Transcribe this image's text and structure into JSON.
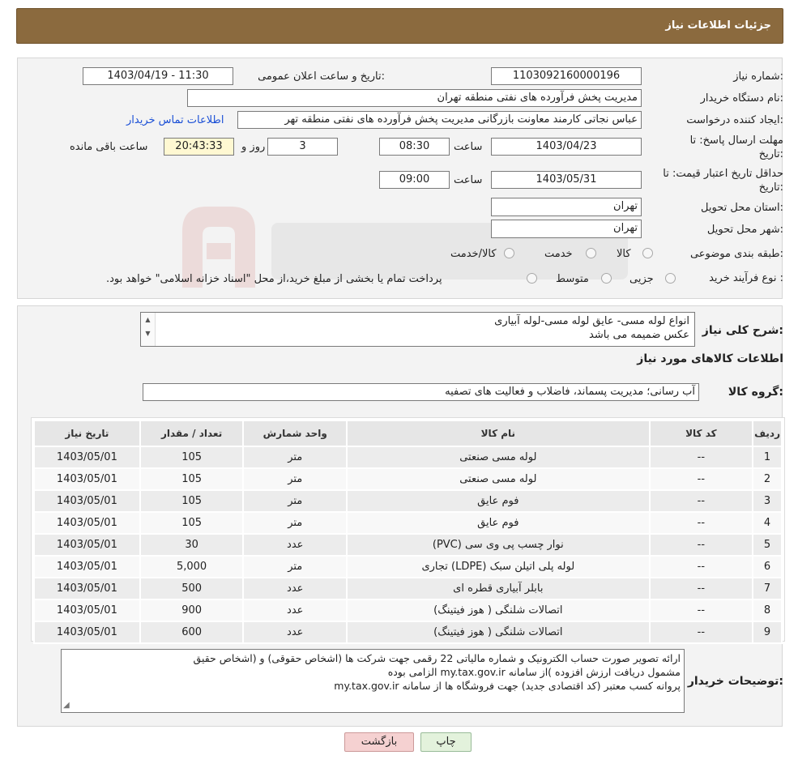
{
  "header": {
    "title": "جزئیات اطلاعات نیاز"
  },
  "form": {
    "need_number_label": "شماره نیاز:",
    "need_number": "1103092160000196",
    "announce_label": "تاریخ و ساعت اعلان عمومی:",
    "announce_value": "1403/04/19 - 11:30",
    "buyer_org_label": "نام دستگاه خریدار:",
    "buyer_org": "مدیریت پخش فرآورده های نفتی منطقه تهران",
    "creator_label": "ایجاد کننده درخواست:",
    "creator": "عباس نجاتی کارمند معاونت بازرگانی مدیریت پخش فرآورده های نفتی منطقه تهر",
    "contact_link": "اطلاعات تماس خریدار",
    "deadline_label_1": "مهلت ارسال پاسخ: تا",
    "deadline_label_2": "تاریخ:",
    "deadline_date": "1403/04/23",
    "time_label": "ساعت",
    "deadline_time": "08:30",
    "days_value": "3",
    "days_label": "روز و",
    "remaining_time": "20:43:33",
    "remaining_label": "ساعت باقی مانده",
    "validity_label_1": "حداقل تاریخ اعتبار قیمت: تا",
    "validity_label_2": "تاریخ:",
    "validity_date": "1403/05/31",
    "validity_time": "09:00",
    "province_label": "استان محل تحویل:",
    "province": "تهران",
    "city_label": "شهر محل تحویل:",
    "city": "تهران",
    "category_label": "طبقه بندی موضوعی:",
    "category_options": [
      "کالا",
      "خدمت",
      "کالا/خدمت"
    ],
    "process_label": "نوع فرآیند خرید :",
    "process_options": [
      "جزیی",
      "متوسط"
    ],
    "process_note": "پرداخت تمام یا بخشی از مبلغ خرید،از محل \"اسناد خزانه اسلامی\" خواهد بود."
  },
  "details": {
    "summary_label": "شرح کلی نیاز:",
    "summary_lines": [
      "انواع لوله مسی- عایق لوله مسی-لوله آبیاری",
      "عکس ضمیمه می باشد"
    ],
    "goods_info_title": "اطلاعات کالاهای مورد نیاز",
    "goods_group_label": "گروه کالا:",
    "goods_group": "آب رسانی؛ مدیریت پسماند، فاضلاب و فعالیت های تصفیه",
    "columns": [
      "ردیف",
      "کد کالا",
      "نام کالا",
      "واحد شمارش",
      "تعداد / مقدار",
      "تاریخ نیاز"
    ],
    "rows": [
      [
        "1",
        "--",
        "لوله مسی صنعتی",
        "متر",
        "105",
        "1403/05/01"
      ],
      [
        "2",
        "--",
        "لوله مسی صنعتی",
        "متر",
        "105",
        "1403/05/01"
      ],
      [
        "3",
        "--",
        "فوم عایق",
        "متر",
        "105",
        "1403/05/01"
      ],
      [
        "4",
        "--",
        "فوم عایق",
        "متر",
        "105",
        "1403/05/01"
      ],
      [
        "5",
        "--",
        "نوار چسب پی وی سی (PVC)",
        "عدد",
        "30",
        "1403/05/01"
      ],
      [
        "6",
        "--",
        "لوله پلی اتیلن سبک (LDPE) تجاری",
        "متر",
        "5,000",
        "1403/05/01"
      ],
      [
        "7",
        "--",
        "بابلر آبیاری قطره ای",
        "عدد",
        "500",
        "1403/05/01"
      ],
      [
        "8",
        "--",
        "اتصالات شلنگی ( هوز فیتینگ)",
        "عدد",
        "900",
        "1403/05/01"
      ],
      [
        "9",
        "--",
        "اتصالات شلنگی ( هوز فیتینگ)",
        "عدد",
        "600",
        "1403/05/01"
      ]
    ],
    "buyer_notes_label": "توضیحات خریدار:",
    "buyer_notes_lines": [
      "ارائه  تصویر صورت حساب الکترونیک و شماره مالیاتی 22 رقمی  جهت شرکت ها (اشخاص حقوقی) و (اشخاص حقیق",
      "مشمول دریافت ارزش افزوده )از سامانه my.tax.gov.ir  الزامی بوده",
      "پروانه کسب معتبر (کد اقتصادی جدید) جهت فروشگاه ها از سامانه my.tax.gov.ir"
    ]
  },
  "buttons": {
    "print": "چاپ",
    "back": "بازگشت"
  }
}
